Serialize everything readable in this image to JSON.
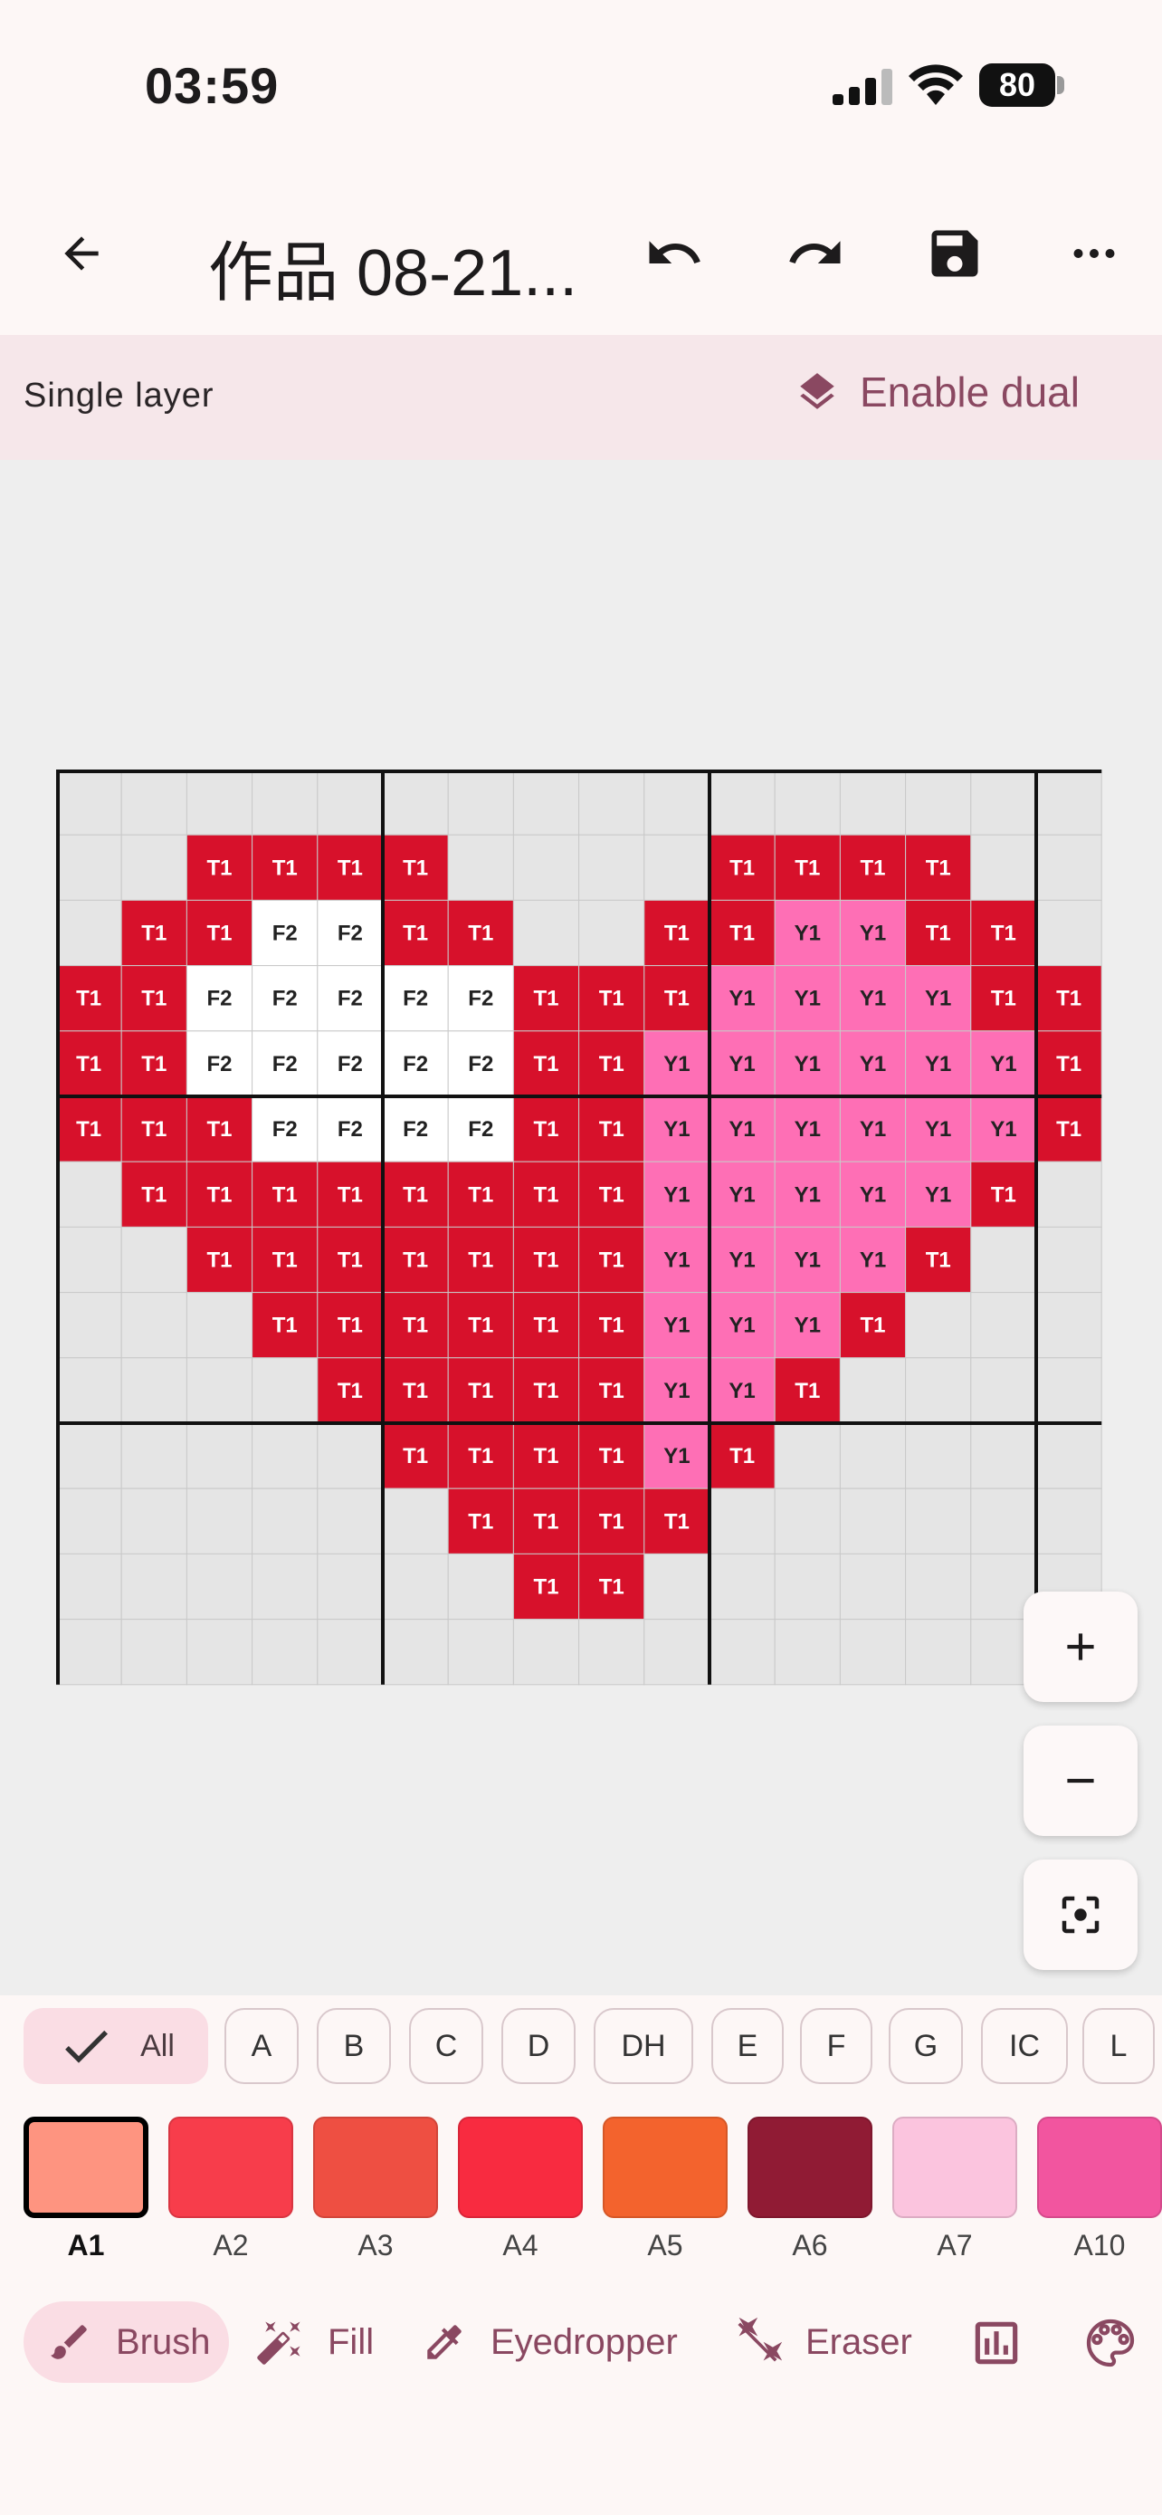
{
  "status_bar": {
    "time": "03:59",
    "battery": "80"
  },
  "app_bar": {
    "title": "作品 08-21..."
  },
  "layer_bar": {
    "mode_label": "Single layer",
    "enable_dual_label": "Enable dual"
  },
  "grid": {
    "cols": 16,
    "rows": 14,
    "color_keys": {
      "T1": "#d7112b",
      "F2": "#ffffff",
      "Y1": "#fe6fb5"
    },
    "empty_color": "#e5e5e5",
    "rows_data": [
      [
        "",
        "",
        "",
        "",
        "",
        "",
        "",
        "",
        "",
        "",
        "",
        "",
        "",
        "",
        "",
        ""
      ],
      [
        "",
        "",
        "T1",
        "T1",
        "T1",
        "T1",
        "",
        "",
        "",
        "",
        "T1",
        "T1",
        "T1",
        "T1",
        "",
        ""
      ],
      [
        "",
        "T1",
        "T1",
        "F2",
        "F2",
        "T1",
        "T1",
        "",
        "",
        "T1",
        "T1",
        "Y1",
        "Y1",
        "T1",
        "T1",
        ""
      ],
      [
        "T1",
        "T1",
        "F2",
        "F2",
        "F2",
        "F2",
        "F2",
        "T1",
        "T1",
        "T1",
        "Y1",
        "Y1",
        "Y1",
        "Y1",
        "T1",
        "T1"
      ],
      [
        "T1",
        "T1",
        "F2",
        "F2",
        "F2",
        "F2",
        "F2",
        "T1",
        "T1",
        "Y1",
        "Y1",
        "Y1",
        "Y1",
        "Y1",
        "Y1",
        "T1"
      ],
      [
        "T1",
        "T1",
        "T1",
        "F2",
        "F2",
        "F2",
        "F2",
        "T1",
        "T1",
        "Y1",
        "Y1",
        "Y1",
        "Y1",
        "Y1",
        "Y1",
        "T1"
      ],
      [
        "",
        "T1",
        "T1",
        "T1",
        "T1",
        "T1",
        "T1",
        "T1",
        "T1",
        "Y1",
        "Y1",
        "Y1",
        "Y1",
        "Y1",
        "T1",
        ""
      ],
      [
        "",
        "",
        "T1",
        "T1",
        "T1",
        "T1",
        "T1",
        "T1",
        "T1",
        "Y1",
        "Y1",
        "Y1",
        "Y1",
        "T1",
        "",
        ""
      ],
      [
        "",
        "",
        "",
        "T1",
        "T1",
        "T1",
        "T1",
        "T1",
        "T1",
        "Y1",
        "Y1",
        "Y1",
        "T1",
        "",
        "",
        ""
      ],
      [
        "",
        "",
        "",
        "",
        "T1",
        "T1",
        "T1",
        "T1",
        "T1",
        "Y1",
        "Y1",
        "T1",
        "",
        "",
        "",
        ""
      ],
      [
        "",
        "",
        "",
        "",
        "",
        "T1",
        "T1",
        "T1",
        "T1",
        "Y1",
        "T1",
        "",
        "",
        "",
        "",
        ""
      ],
      [
        "",
        "",
        "",
        "",
        "",
        "",
        "T1",
        "T1",
        "T1",
        "T1",
        "",
        "",
        "",
        "",
        "",
        ""
      ],
      [
        "",
        "",
        "",
        "",
        "",
        "",
        "",
        "T1",
        "T1",
        "",
        "",
        "",
        "",
        "",
        "",
        ""
      ],
      [
        "",
        "",
        "",
        "",
        "",
        "",
        "",
        "",
        "",
        "",
        "",
        "",
        "",
        "",
        "",
        ""
      ]
    ]
  },
  "filter_chips": [
    {
      "label": "All",
      "selected": true
    },
    {
      "label": "A"
    },
    {
      "label": "B"
    },
    {
      "label": "C"
    },
    {
      "label": "D"
    },
    {
      "label": "DH"
    },
    {
      "label": "E"
    },
    {
      "label": "F"
    },
    {
      "label": "G"
    },
    {
      "label": "IC"
    },
    {
      "label": "L"
    }
  ],
  "colors": [
    {
      "label": "A1",
      "hex": "#fe9480",
      "selected": true
    },
    {
      "label": "A2",
      "hex": "#f73d4b"
    },
    {
      "label": "A3",
      "hex": "#ee4f42"
    },
    {
      "label": "A4",
      "hex": "#f82b40"
    },
    {
      "label": "A5",
      "hex": "#f3632d"
    },
    {
      "label": "A6",
      "hex": "#901b34"
    },
    {
      "label": "A7",
      "hex": "#fbc4de"
    },
    {
      "label": "A10",
      "hex": "#f2559f"
    }
  ],
  "tools": {
    "brush": "Brush",
    "fill": "Fill",
    "eyedropper": "Eyedropper",
    "eraser": "Eraser"
  },
  "theme": {
    "accent": "#8a4861",
    "selected_bg": "#fadde4"
  }
}
